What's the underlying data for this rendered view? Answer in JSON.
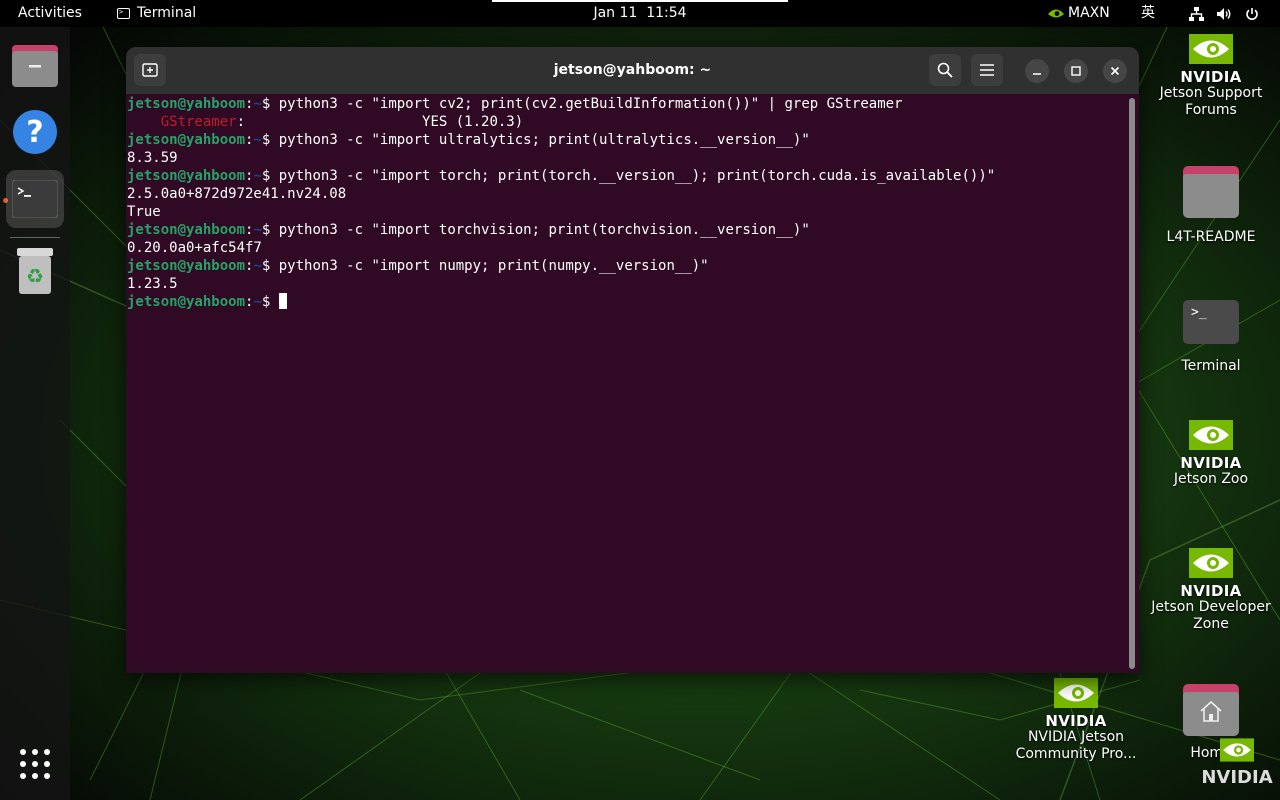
{
  "topbar": {
    "activities": "Activities",
    "app_name": "Terminal",
    "date": "Jan 11",
    "time": "11:54",
    "power_mode": "MAXN",
    "input_method": "英"
  },
  "window": {
    "title": "jetson@yahboom: ~",
    "prompt_user": "jetson@yahboom",
    "prompt_sep": ":",
    "prompt_path": "~",
    "prompt_symbol": "$ ",
    "lines": {
      "cmd1": "python3 -c \"import cv2; print(cv2.getBuildInformation())\" | grep GStreamer",
      "out1_indent": "    ",
      "out1_label": "GStreamer",
      "out1_rest": ":                     YES (1.20.3)",
      "cmd2": "python3 -c \"import ultralytics; print(ultralytics.__version__)\"",
      "out2": "8.3.59",
      "cmd3": "python3 -c \"import torch; print(torch.__version__); print(torch.cuda.is_available())\"",
      "out3a": "2.5.0a0+872d972e41.nv24.08",
      "out3b": "True",
      "cmd4": "python3 -c \"import torchvision; print(torchvision.__version__)\"",
      "out4": "0.20.0a0+afc54f7",
      "cmd5": "python3 -c \"import numpy; print(numpy.__version__)\"",
      "out5": "1.23.5"
    }
  },
  "desktop": {
    "nvidia_word": "NVIDIA",
    "support_forums_line1": "Jetson Support",
    "support_forums_line2": "Forums",
    "readme": "L4T-README",
    "terminal": "Terminal",
    "zoo": "Jetson Zoo",
    "devzone_line1": "Jetson Developer",
    "devzone_line2": "Zone",
    "community_line1": "NVIDIA Jetson",
    "community_line2": "Community Pro...",
    "home": "Home"
  },
  "colors": {
    "terminal_bg": "#300a24",
    "prompt_user": "#26a269",
    "prompt_path": "#12488b",
    "grep_highlight": "#c01c28",
    "nvidia_green": "#76b900",
    "accent": "#e95420"
  }
}
